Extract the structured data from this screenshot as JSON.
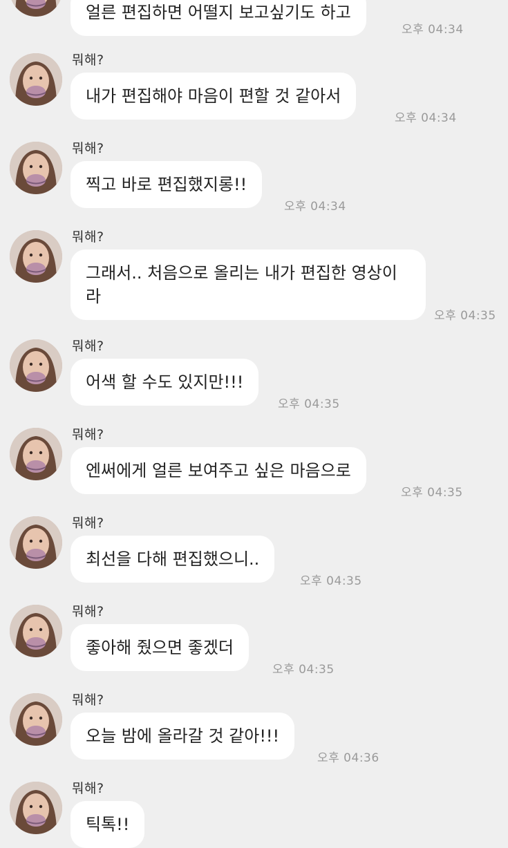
{
  "messages": [
    {
      "sender": "",
      "text": "얼른 편집하면 어떨지 보고싶기도 하고",
      "time": "오후 04:34"
    },
    {
      "sender": "뭐해?",
      "text": "내가 편집해야 마음이 편할 것 같아서",
      "time": "오후 04:34"
    },
    {
      "sender": "뭐해?",
      "text": "찍고 바로 편집했지롱!!",
      "time": "오후 04:34"
    },
    {
      "sender": "뭐해?",
      "text": "그래서.. 처음으로 올리는 내가 편집한 영상이라",
      "time": "오후 04:35"
    },
    {
      "sender": "뭐해?",
      "text": "어색 할 수도 있지만!!!",
      "time": "오후 04:35"
    },
    {
      "sender": "뭐해?",
      "text": "엔써에게 얼른 보여주고 싶은 마음으로",
      "time": "오후 04:35"
    },
    {
      "sender": "뭐해?",
      "text": "최선을 다해 편집했으니..",
      "time": "오후 04:35"
    },
    {
      "sender": "뭐해?",
      "text": "좋아해 줬으면 좋겠더",
      "time": "오후 04:35"
    },
    {
      "sender": "뭐해?",
      "text": "오늘 밤에 올라갈 것 같아!!!",
      "time": "오후 04:36"
    },
    {
      "sender": "뭐해?",
      "text": "틱톡!!",
      "time": ""
    }
  ]
}
